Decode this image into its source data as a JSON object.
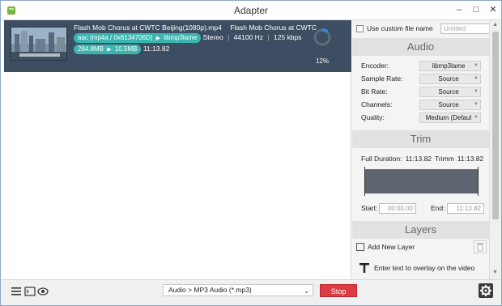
{
  "window": {
    "title": "Adapter"
  },
  "queue": {
    "item": {
      "file_name": "Flash Mob Chorus at CWTC Beijing(1080p).mp4",
      "output_name": "Flash Mob Chorus at CWTC",
      "codec_from": "aac (mp4a / 0x6134706D)",
      "codec_to": "libmp3lame",
      "channels": "Stereo",
      "sample_rate": "44100 Hz",
      "bitrate": "125 kbps",
      "size_from": "284.8MB",
      "size_to": "10.5MB",
      "duration": "11:13.82",
      "progress_label": "12%",
      "progress": 0.12
    }
  },
  "right_panel": {
    "custom_file_name_label": "Use custom file name",
    "custom_file_name_placeholder": "Untitled",
    "audio": {
      "header": "Audio",
      "encoder_label": "Encoder:",
      "encoder_value": "libmp3lame",
      "sample_rate_label": "Sample Rate:",
      "sample_rate_value": "Source",
      "bit_rate_label": "Bit Rate:",
      "bit_rate_value": "Source",
      "channels_label": "Channels:",
      "channels_value": "Source",
      "quality_label": "Quality:",
      "quality_value": "Medium (Defaul"
    },
    "trim": {
      "header": "Trim",
      "full_duration_label": "Full Duration:",
      "full_duration_value": "11:13.82",
      "trimmed_label": "Trimm",
      "trimmed_value": "11:13.82",
      "start_label": "Start:",
      "start_value": "00:00.00",
      "end_label": "End:",
      "end_value": "11:13.82"
    },
    "layers": {
      "header": "Layers",
      "add_layer_label": "Add New Layer",
      "text_layer_label": "Enter text to overlay on the video"
    }
  },
  "bottom_bar": {
    "format_value": "Audio > MP3 Audio (*.mp3)",
    "stop_label": "Stop"
  },
  "colors": {
    "queue_item_bg": "#3d4e62",
    "pill": "#3ab5b0",
    "stop": "#dd3b44",
    "spinner": "#2e8ad8"
  }
}
